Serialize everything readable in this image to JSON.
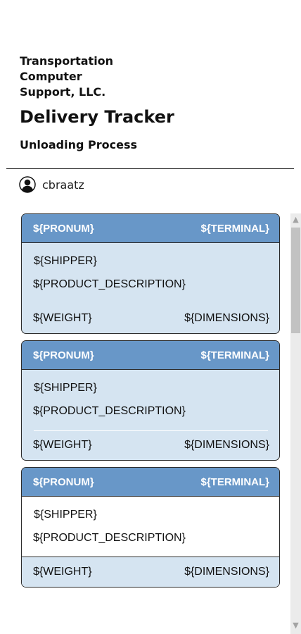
{
  "header": {
    "company": "Transportation Computer Support, LLC.",
    "app_title": "Delivery Tracker",
    "subtitle": "Unloading Process"
  },
  "user": {
    "icon": "user-avatar-icon",
    "name": "cbraatz"
  },
  "cards": [
    {
      "pronum": "${PRONUM}",
      "terminal": "${TERMINAL}",
      "shipper": "${SHIPPER}",
      "product_description": "${PRODUCT_DESCRIPTION}",
      "weight": "${WEIGHT}",
      "dimensions": "${DIMENSIONS}"
    },
    {
      "pronum": "${PRONUM}",
      "terminal": "${TERMINAL}",
      "shipper": "${SHIPPER}",
      "product_description": "${PRODUCT_DESCRIPTION}",
      "weight": "${WEIGHT}",
      "dimensions": "${DIMENSIONS}"
    },
    {
      "pronum": "${PRONUM}",
      "terminal": "${TERMINAL}",
      "shipper": "${SHIPPER}",
      "product_description": "${PRODUCT_DESCRIPTION}",
      "weight": "${WEIGHT}",
      "dimensions": "${DIMENSIONS}"
    }
  ],
  "colors": {
    "card_header": "#6897c8",
    "card_body": "#d5e4f1",
    "border": "#2c2c2c"
  }
}
